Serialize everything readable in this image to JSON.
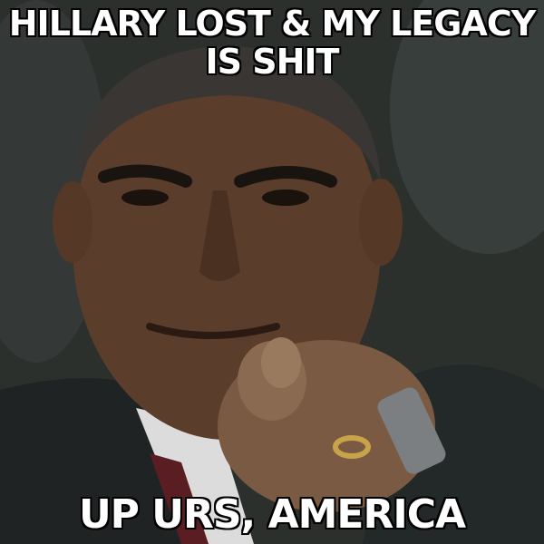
{
  "meme": {
    "top_text": "HILLARY LOST & MY LEGACY IS SHIT",
    "bottom_text": "UP URS, AMERICA"
  }
}
